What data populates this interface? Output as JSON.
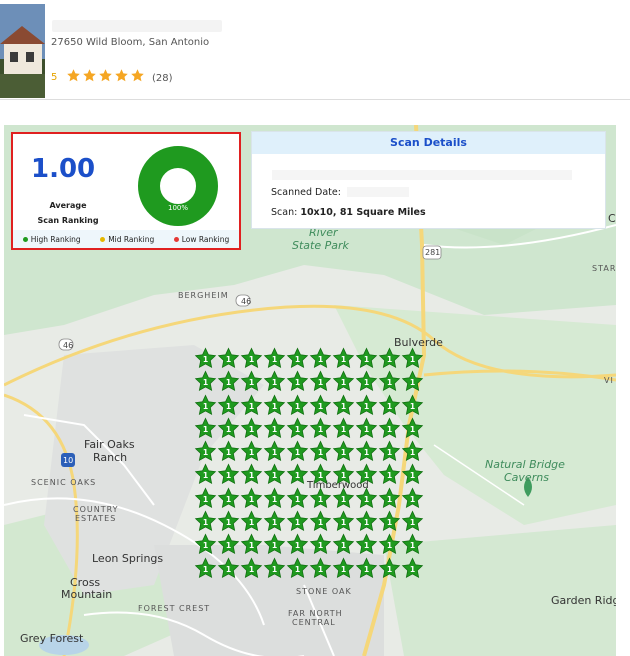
{
  "listing": {
    "address": "27650 Wild Bloom, San Antonio",
    "rating": "5",
    "review_count": "(28)",
    "star_color": "#f5a623"
  },
  "summary": {
    "average_value": "1.00",
    "average_label_line1": "Average",
    "average_label_line2": "Scan Ranking",
    "donut_percent": "100%",
    "donut_color": "#1f9a1f",
    "legend": [
      {
        "label": "High Ranking",
        "color": "#1f9a1f"
      },
      {
        "label": "Mid Ranking",
        "color": "#e6b800"
      },
      {
        "label": "Low Ranking",
        "color": "#e53935"
      }
    ]
  },
  "scan_details": {
    "title": "Scan Details",
    "scanned_date_label": "Scanned Date:",
    "scan_label": "Scan:",
    "scan_value": "10x10, 81 Square Miles"
  },
  "map": {
    "labels": {
      "river": "River",
      "state_park": "State Park",
      "bergheim": "BERGHEIM",
      "bulverde": "Bulverde",
      "fair_oaks": "Fair Oaks",
      "ranch": "Ranch",
      "scenic_oaks": "SCENIC OAKS",
      "country": "COUNTRY",
      "estates": "ESTATES",
      "leon_springs": "Leon Springs",
      "cross": "Cross",
      "mountain": "Mountain",
      "forest_crest": "FOREST CREST",
      "stone_oak": "STONE OAK",
      "far_north": "FAR NORTH",
      "central": "CENTRAL",
      "grey_forest": "Grey Forest",
      "garden_ridge": "Garden Ridge",
      "natural_bridge": "Natural Bridge",
      "caverns": "Caverns",
      "star": "STAR",
      "vi": "VI",
      "ca": "Ca",
      "timberwood": "Timberwood",
      "route_46_a": "46",
      "route_46_b": "46",
      "route_281": "281",
      "route_10": "10"
    },
    "grid_rows": 10,
    "grid_cols": 10,
    "marker_rank": "1",
    "marker_color": "#1f9a1f"
  }
}
